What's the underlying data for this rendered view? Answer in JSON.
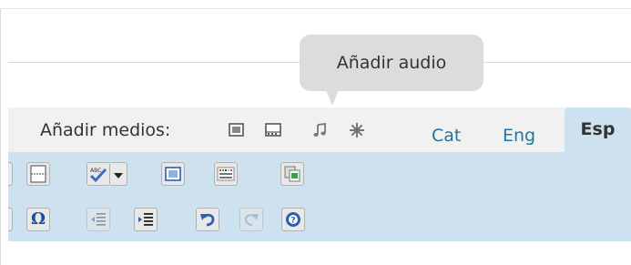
{
  "tooltip": {
    "text": "Añadir audio"
  },
  "media": {
    "label": "Añadir medios:",
    "icons": [
      "add-image-icon",
      "add-video-icon",
      "add-audio-icon",
      "add-media-icon"
    ]
  },
  "languages": {
    "tabs": [
      {
        "label": "Cat",
        "active": false
      },
      {
        "label": "Eng",
        "active": false
      },
      {
        "label": "Esp",
        "active": true
      }
    ]
  },
  "toolbar": {
    "row1": [
      "page-break-icon",
      "spellcheck-icon",
      "spellcheck-dropdown-icon",
      "fullscreen-icon",
      "kitchen-sink-icon",
      "paste-word-icon"
    ],
    "row2": [
      "special-character-icon",
      "outdent-icon",
      "indent-icon",
      "undo-icon",
      "redo-icon",
      "help-icon"
    ],
    "special_character_label": "Ω",
    "spellcheck_label": "ABC"
  },
  "colors": {
    "toolbar_bg": "#cee1ef",
    "media_bar_bg": "#f1f1f1",
    "link": "#21759b",
    "tooltip_bg": "#dcdcdc"
  }
}
